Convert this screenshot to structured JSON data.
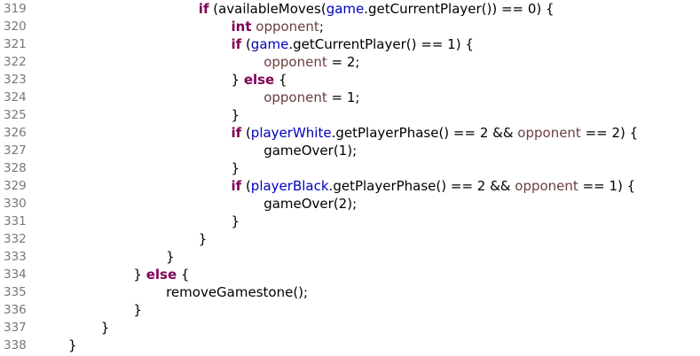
{
  "editor": {
    "lines": [
      {
        "number": "319",
        "indent": 4,
        "tokens": [
          {
            "t": "if",
            "c": "kw"
          },
          {
            "t": " (availableMoves(",
            "c": "plain"
          },
          {
            "t": "game",
            "c": "fld"
          },
          {
            "t": ".getCurrentPlayer()) == 0) {",
            "c": "plain"
          }
        ]
      },
      {
        "number": "320",
        "indent": 5,
        "tokens": [
          {
            "t": "int",
            "c": "kw"
          },
          {
            "t": " ",
            "c": "plain"
          },
          {
            "t": "opponent",
            "c": "loc"
          },
          {
            "t": ";",
            "c": "plain"
          }
        ]
      },
      {
        "number": "321",
        "indent": 5,
        "tokens": [
          {
            "t": "if",
            "c": "kw"
          },
          {
            "t": " (",
            "c": "plain"
          },
          {
            "t": "game",
            "c": "fld"
          },
          {
            "t": ".getCurrentPlayer() == 1) {",
            "c": "plain"
          }
        ]
      },
      {
        "number": "322",
        "indent": 6,
        "tokens": [
          {
            "t": "opponent",
            "c": "loc"
          },
          {
            "t": " = 2;",
            "c": "plain"
          }
        ]
      },
      {
        "number": "323",
        "indent": 5,
        "tokens": [
          {
            "t": "} ",
            "c": "plain"
          },
          {
            "t": "else",
            "c": "kw"
          },
          {
            "t": " {",
            "c": "plain"
          }
        ]
      },
      {
        "number": "324",
        "indent": 6,
        "tokens": [
          {
            "t": "opponent",
            "c": "loc"
          },
          {
            "t": " = 1;",
            "c": "plain"
          }
        ]
      },
      {
        "number": "325",
        "indent": 5,
        "tokens": [
          {
            "t": "}",
            "c": "plain"
          }
        ]
      },
      {
        "number": "326",
        "indent": 5,
        "tokens": [
          {
            "t": "if",
            "c": "kw"
          },
          {
            "t": " (",
            "c": "plain"
          },
          {
            "t": "playerWhite",
            "c": "fld"
          },
          {
            "t": ".getPlayerPhase() == 2 && ",
            "c": "plain"
          },
          {
            "t": "opponent",
            "c": "loc"
          },
          {
            "t": " == 2) {",
            "c": "plain"
          }
        ]
      },
      {
        "number": "327",
        "indent": 6,
        "tokens": [
          {
            "t": "gameOver(1);",
            "c": "plain"
          }
        ]
      },
      {
        "number": "328",
        "indent": 5,
        "tokens": [
          {
            "t": "}",
            "c": "plain"
          }
        ]
      },
      {
        "number": "329",
        "indent": 5,
        "tokens": [
          {
            "t": "if",
            "c": "kw"
          },
          {
            "t": " (",
            "c": "plain"
          },
          {
            "t": "playerBlack",
            "c": "fld"
          },
          {
            "t": ".getPlayerPhase() == 2 && ",
            "c": "plain"
          },
          {
            "t": "opponent",
            "c": "loc"
          },
          {
            "t": " == 1) {",
            "c": "plain"
          }
        ]
      },
      {
        "number": "330",
        "indent": 6,
        "tokens": [
          {
            "t": "gameOver(2);",
            "c": "plain"
          }
        ]
      },
      {
        "number": "331",
        "indent": 5,
        "tokens": [
          {
            "t": "}",
            "c": "plain"
          }
        ]
      },
      {
        "number": "332",
        "indent": 4,
        "tokens": [
          {
            "t": "}",
            "c": "plain"
          }
        ]
      },
      {
        "number": "333",
        "indent": 3,
        "tokens": [
          {
            "t": "}",
            "c": "plain"
          }
        ]
      },
      {
        "number": "334",
        "indent": 2,
        "tokens": [
          {
            "t": "} ",
            "c": "plain"
          },
          {
            "t": "else",
            "c": "kw"
          },
          {
            "t": " {",
            "c": "plain"
          }
        ]
      },
      {
        "number": "335",
        "indent": 3,
        "tokens": [
          {
            "t": "removeGamestone();",
            "c": "plain"
          }
        ]
      },
      {
        "number": "336",
        "indent": 2,
        "tokens": [
          {
            "t": "}",
            "c": "plain"
          }
        ]
      },
      {
        "number": "337",
        "indent": 1,
        "tokens": [
          {
            "t": "}",
            "c": "plain"
          }
        ]
      },
      {
        "number": "338",
        "indent": 0,
        "tokens": [
          {
            "t": "}",
            "c": "plain"
          }
        ]
      }
    ]
  },
  "colors": {
    "keyword": "#7f0055",
    "field": "#0000c0",
    "local_variable": "#6a3e3e",
    "line_number": "#787878",
    "text": "#000000",
    "background": "#ffffff"
  }
}
